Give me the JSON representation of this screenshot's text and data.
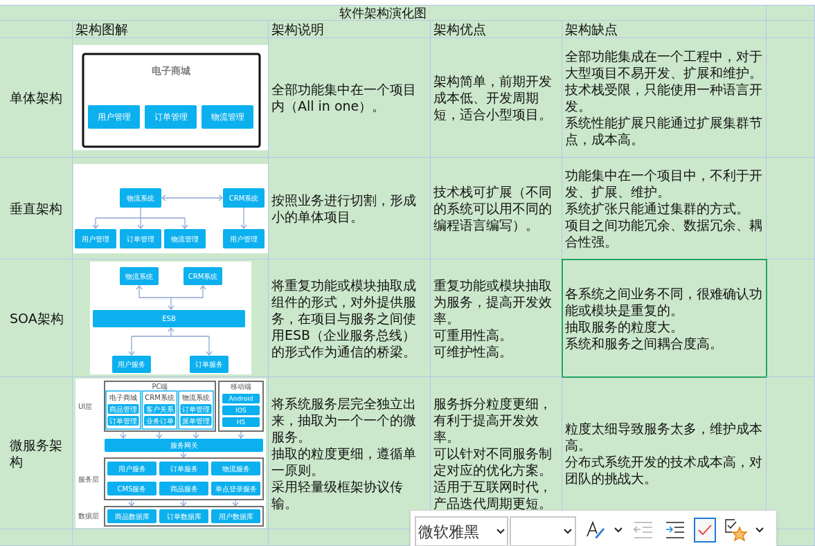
{
  "title": "软件架构演化图",
  "columns": [
    "架构图解",
    "架构说明",
    "架构优点",
    "架构缺点"
  ],
  "rows": [
    {
      "name": "单体架构",
      "diagram": {
        "kind": "monolith",
        "title": "电子商城",
        "modules": [
          "用户管理",
          "订单管理",
          "物流管理"
        ]
      },
      "description": [
        "全部功能集中在一个项目内（All in one）。"
      ],
      "pros": [
        "架构简单，前期开发成本低、开发周期短，适合小型项目。"
      ],
      "cons": {
        "paragraphs": [
          "全部功能集成在一个工程中，对于大型项目不易开发、扩展和维护。",
          "技术栈受限，只能使用一种语言开发。",
          "系统性能扩展只能通过扩展集群节点，成本高。"
        ],
        "selected": false
      }
    },
    {
      "name": "垂直架构",
      "diagram": {
        "kind": "vertical",
        "systems": [
          {
            "name": "物流系统",
            "modules": [
              "用户管理",
              "订单管理",
              "物流管理"
            ]
          },
          {
            "name": "CRM系统",
            "modules": [
              "用户管理"
            ]
          }
        ]
      },
      "description": [
        "按照业务进行切割，形成小的单体项目。"
      ],
      "pros": [
        "技术栈可扩展（不同的系统可以用不同的编程语言编写）。"
      ],
      "cons": {
        "paragraphs": [
          "功能集中在一个项目中，不利于开发、扩展、维护。",
          "系统扩张只能通过集群的方式。",
          "项目之间功能冗余、数据冗余、耦合性强。"
        ],
        "selected": false
      }
    },
    {
      "name": "SOA架构",
      "diagram": {
        "kind": "soa",
        "systems": [
          "物流系统",
          "CRM系统"
        ],
        "bus": "ESB",
        "services": [
          "用户服务",
          "订单服务"
        ]
      },
      "description": [
        "将重复功能或模块抽取成组件的形式，对外提供服务，在项目与服务之间使用ESB（企业服务总线）的形式作为通信的桥梁。"
      ],
      "pros": [
        "重复功能或模块抽取为服务，提高开发效率。",
        "可重用性高。",
        "可维护性高。"
      ],
      "cons": {
        "paragraphs": [
          "各系统之间业务不同，很难确认功能或模块是重复的。",
          "抽取服务的粒度大。",
          "系统和服务之间耦合度高。"
        ],
        "selected": true
      }
    },
    {
      "name": "微服务架构",
      "diagram": {
        "kind": "microservice",
        "layers": [
          "UI层",
          "服务层",
          "数据层"
        ],
        "pc": {
          "title": "PC端",
          "apps": [
            {
              "name": "电子商城",
              "modules": [
                "商品管理",
                "订单管理"
              ]
            },
            {
              "name": "CRM系统",
              "modules": [
                "客户关系",
                "业务订单"
              ]
            },
            {
              "name": "物流系统",
              "modules": [
                "订单管理",
                "派单管理"
              ]
            }
          ]
        },
        "mobile": {
          "title": "移动端",
          "clients": [
            "Android",
            "IOS",
            "H5"
          ]
        },
        "gateway": "服务网关",
        "services": [
          "用户服务",
          "订单服务",
          "物流服务",
          "CMS服务",
          "商品服务",
          "单点登录服务"
        ],
        "databases": [
          "商品数据库",
          "订单数据库",
          "用户数据库"
        ]
      },
      "description": [
        "将系统服务层完全独立出来，抽取为一个一个的微服务。",
        "抽取的粒度更细，遵循单一原则。",
        "采用轻量级框架协议传输。"
      ],
      "pros": [
        "服务拆分粒度更细，有利于提高开发效率。",
        "可以针对不同服务制定对应的优化方案。",
        "适用于互联网时代，产品迭代周期更短。"
      ],
      "cons": {
        "paragraphs": [
          "粒度太细导致服务太多，维护成本高。",
          "分布式系统开发的技术成本高，对团队的挑战大。"
        ],
        "selected": false
      }
    }
  ],
  "toolbar": {
    "font": "微软雅黑",
    "tools": [
      {
        "kind": "font-style",
        "menu": true,
        "disabled": false,
        "selected": false
      },
      {
        "kind": "decrease-indent",
        "menu": false,
        "disabled": true,
        "selected": false
      },
      {
        "kind": "increase-indent",
        "menu": false,
        "disabled": false,
        "selected": false
      },
      {
        "kind": "check",
        "menu": false,
        "disabled": false,
        "selected": true
      },
      {
        "kind": "check-star",
        "menu": true,
        "disabled": false,
        "selected": false
      }
    ]
  }
}
